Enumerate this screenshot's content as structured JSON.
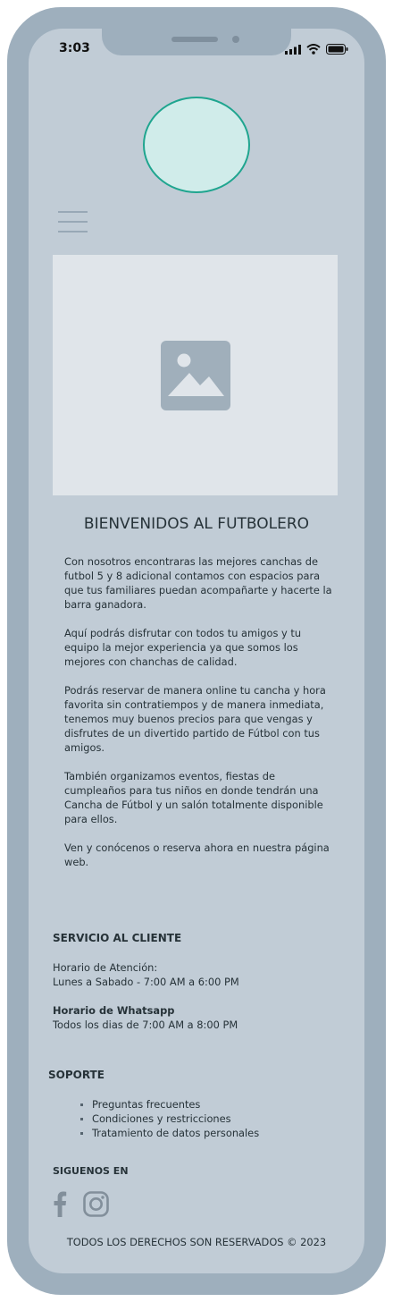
{
  "status_bar": {
    "time": "3:03",
    "icons": [
      "cellular-signal-icon",
      "wifi-icon",
      "battery-icon"
    ]
  },
  "header": {
    "logo": "logo-placeholder",
    "menu_icon": "hamburger-menu-icon"
  },
  "hero": {
    "image_icon": "image-placeholder-icon"
  },
  "main": {
    "heading": "BIENVENIDOS AL FUTBOLERO",
    "paragraphs": [
      "Con nosotros encontraras las mejores canchas de futbol 5 y 8 adicional contamos con espacios para que tus familiares puedan acompañarte y hacerte la barra ganadora.",
      "Aquí podrás disfrutar con todos tu amigos y tu equipo la mejor experiencia ya que somos los mejores con chanchas de calidad.",
      "Podrás reservar de manera online tu cancha y hora favorita sin contratiempos y de manera inmediata, tenemos muy buenos precios para que vengas y disfrutes de un divertido partido de Fútbol con tus amigos.",
      "También organizamos eventos, fiestas de cumpleaños para tus niños en donde tendrán una Cancha de Fútbol  y un salón totalmente disponible para ellos.",
      "Ven y conócenos o reserva ahora en  nuestra página web."
    ]
  },
  "customer_service": {
    "title": "SERVICIO AL CLIENTE",
    "hours_label": "Horario de Atención:",
    "hours": "Lunes a Sabado - 7:00 AM a 6:00 PM",
    "whatsapp_label": "Horario de Whatsapp",
    "whatsapp_hours": "Todos los dias de 7:00 AM a 8:00 PM"
  },
  "support": {
    "title": "SOPORTE",
    "links": [
      "Preguntas frecuentes",
      "Condiciones y restricciones",
      "Tratamiento de datos personales"
    ]
  },
  "follow": {
    "title": "SIGUENOS EN",
    "icons": [
      "facebook-icon",
      "instagram-icon"
    ]
  },
  "footer": {
    "copyright": "TODOS LOS DERECHOS SON RESERVADOS © 2023"
  },
  "colors": {
    "device_frame": "#9eafbd",
    "screen_bg": "#c1ccd6",
    "logo_border": "#1fa58f",
    "logo_fill": "#d0ecea",
    "hero_bg": "#e0e5ea",
    "text": "#263238"
  }
}
